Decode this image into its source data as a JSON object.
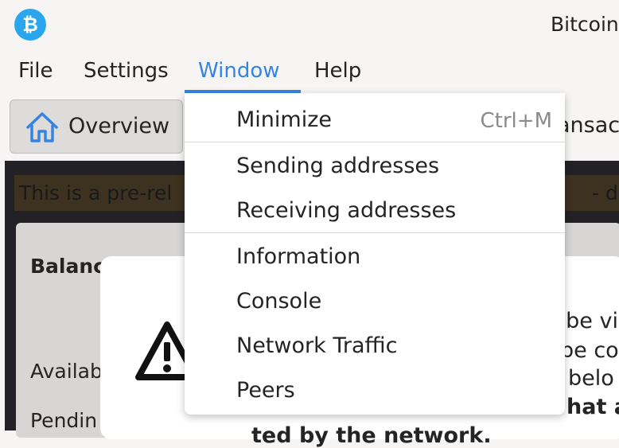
{
  "window": {
    "title": "Bitcoin"
  },
  "menubar": {
    "file": "File",
    "settings": "Settings",
    "window": "Window",
    "help": "Help"
  },
  "toolbar": {
    "overview": "Overview",
    "transactions": "ansac"
  },
  "warning_banner": "This is a pre-rel",
  "warning_banner_end": "- do",
  "panel": {
    "heading": "Balanc",
    "available": "Availab",
    "pending": "Pendin"
  },
  "dialog": {
    "line1": "t be vi",
    "line2": "be co",
    "line3": "belo",
    "line4": "hat ar",
    "line5": "ted by the network."
  },
  "window_menu": {
    "items": [
      {
        "label": "Minimize",
        "shortcut": "Ctrl+M"
      },
      {
        "label": "Sending addresses"
      },
      {
        "label": "Receiving addresses"
      },
      {
        "label": "Information"
      },
      {
        "label": "Console"
      },
      {
        "label": "Network Traffic"
      },
      {
        "label": "Peers"
      }
    ]
  },
  "colors": {
    "accent": "#3584e4",
    "app_icon": "#2aa6ee",
    "banner": "#3d3120"
  },
  "icons": {
    "app": "bitcoin-icon",
    "overview": "home-icon",
    "dialog": "warning-icon"
  }
}
